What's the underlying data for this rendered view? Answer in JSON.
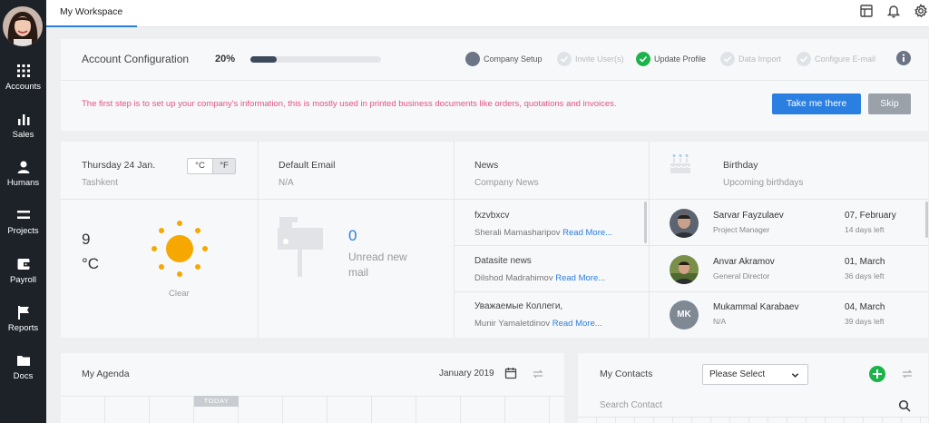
{
  "sidebar": {
    "items": [
      {
        "label": "Accounts",
        "icon": "grid-icon"
      },
      {
        "label": "Sales",
        "icon": "bar-chart-icon"
      },
      {
        "label": "Humans",
        "icon": "user-icon"
      },
      {
        "label": "Projects",
        "icon": "menu-icon"
      },
      {
        "label": "Payroll",
        "icon": "wallet-icon"
      },
      {
        "label": "Reports",
        "icon": "flag-icon"
      },
      {
        "label": "Docs",
        "icon": "folder-icon"
      }
    ]
  },
  "topbar": {
    "tab": "My Workspace"
  },
  "config": {
    "title": "Account Configuration",
    "percent_label": "20%",
    "progress": 0.2,
    "steps": [
      {
        "label": "Company Setup",
        "state": "current"
      },
      {
        "label": "Invite User(s)",
        "state": "todo"
      },
      {
        "label": "Update Profile",
        "state": "done"
      },
      {
        "label": "Data Import",
        "state": "todo"
      },
      {
        "label": "Configure E-mail",
        "state": "todo"
      }
    ],
    "message": "The first step is to set up your company's information, this is mostly used in printed business documents like orders, quotations and invoices.",
    "primary_button": "Take me there",
    "skip_button": "Skip"
  },
  "weather": {
    "date": "Thursday 24 Jan.",
    "city": "Tashkent",
    "unit_c": "°C",
    "unit_f": "°F",
    "temp": "9",
    "temp_unit": "°C",
    "condition": "Clear"
  },
  "email": {
    "title": "Default Email",
    "value": "N/A",
    "count": "0",
    "caption": "Unread new mail"
  },
  "news": {
    "title": "News",
    "subtitle": "Company News",
    "read_more": "Read More...",
    "items": [
      {
        "headline": "fxzvbxcv",
        "author": "Sherali Mamasharipov"
      },
      {
        "headline": "Datasite news",
        "author": "Dilshod Madrahimov"
      },
      {
        "headline": "Уважаемые Коллеги,",
        "author": "Munir Yamaletdinov"
      }
    ]
  },
  "birthday": {
    "title": "Birthday",
    "subtitle": "Upcoming birthdays",
    "people": [
      {
        "name": "Sarvar Fayzulaev",
        "role": "Project Manager",
        "date": "07, February",
        "left": "14 days left"
      },
      {
        "name": "Anvar Akramov",
        "role": "General Director",
        "date": "01, March",
        "left": "36 days left"
      },
      {
        "name": "Mukammal Karabaev",
        "role": "N/A",
        "date": "04, March",
        "left": "39 days left",
        "initials": "MK"
      }
    ]
  },
  "agenda": {
    "title": "My Agenda",
    "month": "January 2019",
    "today": "TODAY"
  },
  "contacts": {
    "title": "My Contacts",
    "select": "Please Select",
    "search_placeholder": "Search Contact"
  },
  "colors": {
    "accent": "#2a7fe0",
    "success": "#1bb34a",
    "message": "#e0557f",
    "sidebar": "#1d2228"
  }
}
